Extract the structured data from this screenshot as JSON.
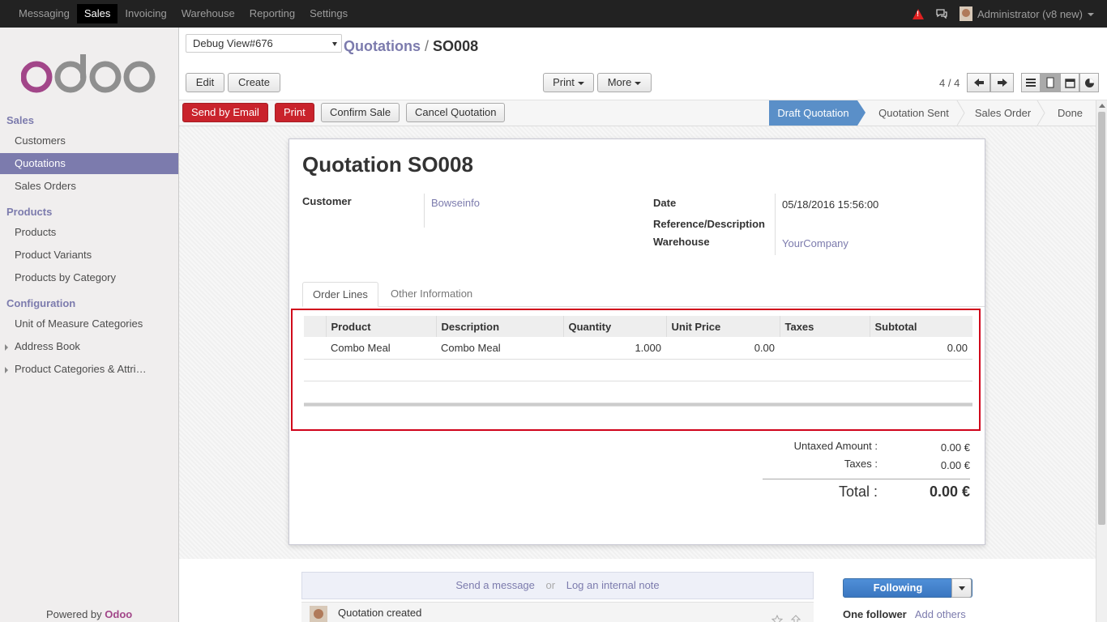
{
  "topbar": {
    "menu": [
      "Messaging",
      "Sales",
      "Invoicing",
      "Warehouse",
      "Reporting",
      "Settings"
    ],
    "active_menu": "Sales",
    "user": "Administrator (v8  new)"
  },
  "sidebar": {
    "logo_text": "odoo",
    "sections": [
      {
        "title": "Sales",
        "items": [
          {
            "label": "Customers"
          },
          {
            "label": "Quotations",
            "active": true
          },
          {
            "label": "Sales Orders"
          }
        ]
      },
      {
        "title": "Products",
        "items": [
          {
            "label": "Products"
          },
          {
            "label": "Product Variants"
          },
          {
            "label": "Products by Category"
          }
        ]
      },
      {
        "title": "Configuration",
        "items": [
          {
            "label": "Unit of Measure Categories"
          },
          {
            "label": "Address Book",
            "expandable": true
          },
          {
            "label": "Product Categories & Attri…",
            "expandable": true
          }
        ]
      }
    ],
    "powered_by": "Powered by",
    "powered_brand": "Odoo"
  },
  "control_panel": {
    "debug_select": "Debug View#676",
    "breadcrumb_parent": "Quotations",
    "breadcrumb_sep": "/",
    "breadcrumb_current": "SO008",
    "edit_label": "Edit",
    "create_label": "Create",
    "print_label": "Print",
    "more_label": "More",
    "pager": "4 / 4"
  },
  "statusbar": {
    "buttons": {
      "send_email": "Send by Email",
      "print": "Print",
      "confirm": "Confirm Sale",
      "cancel": "Cancel Quotation"
    },
    "stages": [
      "Draft Quotation",
      "Quotation Sent",
      "Sales Order",
      "Done"
    ],
    "active_stage": "Draft Quotation"
  },
  "form": {
    "title": "Quotation SO008",
    "customer_label": "Customer",
    "customer_value": "Bowseinfo",
    "date_label": "Date",
    "date_value": "05/18/2016 15:56:00",
    "reference_label": "Reference/Description",
    "warehouse_label": "Warehouse",
    "warehouse_value": "YourCompany",
    "tabs": [
      "Order Lines",
      "Other Information"
    ],
    "order_lines": {
      "headers": [
        "Product",
        "Description",
        "Quantity",
        "Unit Price",
        "Taxes",
        "Subtotal"
      ],
      "rows": [
        {
          "product": "Combo Meal",
          "description": "Combo Meal",
          "quantity": "1.000",
          "unit_price": "0.00",
          "taxes": "",
          "subtotal": "0.00"
        }
      ]
    },
    "totals": {
      "untaxed_label": "Untaxed Amount :",
      "untaxed_value": "0.00 €",
      "taxes_label": "Taxes :",
      "taxes_value": "0.00 €",
      "total_label": "Total :",
      "total_value": "0.00 €"
    }
  },
  "chatter": {
    "send_message": "Send a message",
    "or": "or",
    "log_note": "Log an internal note",
    "following": "Following",
    "followers": "One follower",
    "add_others": "Add others",
    "message_text": "Quotation created"
  },
  "colors": {
    "brand_purple": "#7c7bad",
    "red_button": "#c9232c",
    "active_stage": "#5a8fc8",
    "highlight_box": "#d0021b"
  }
}
